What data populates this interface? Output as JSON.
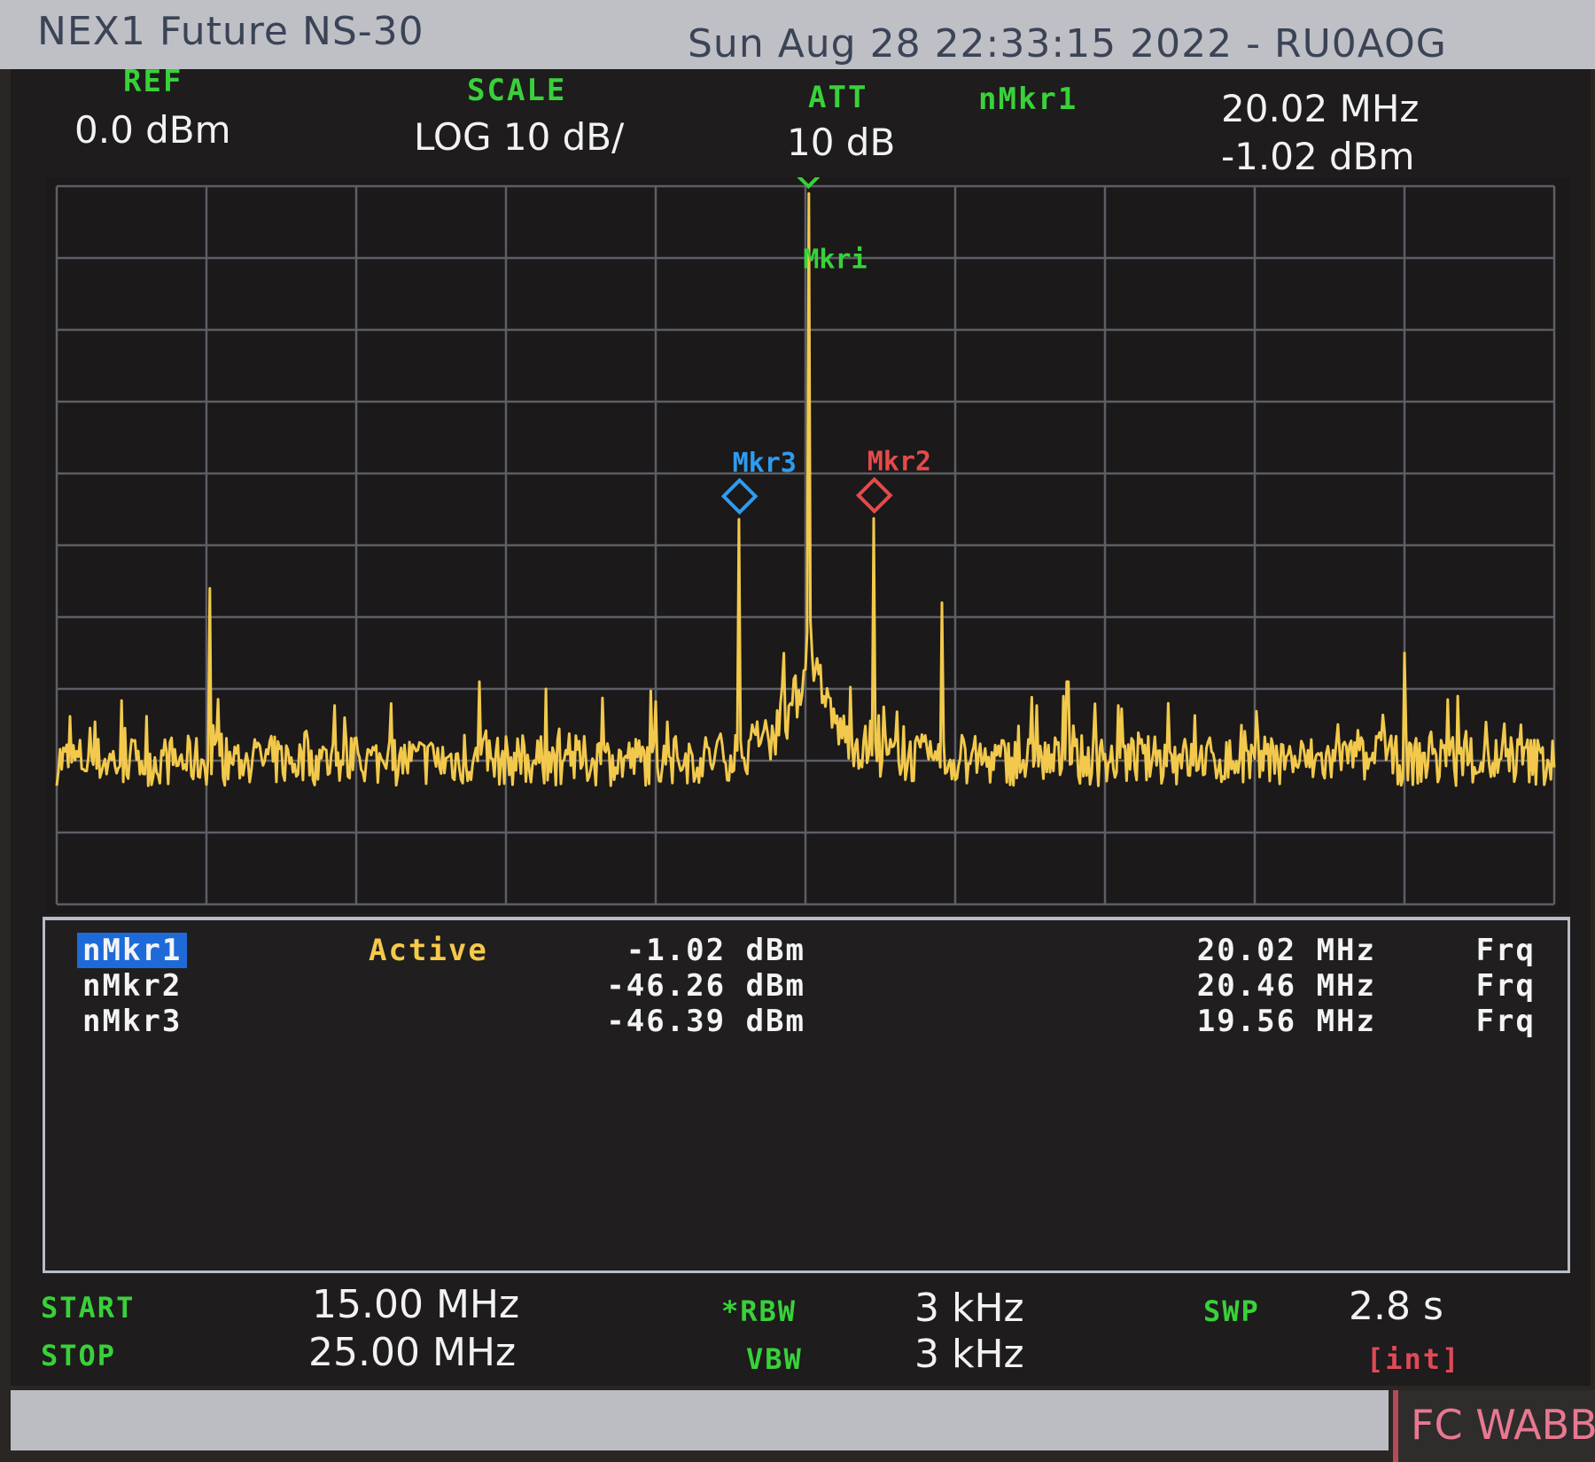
{
  "titlebar": {
    "device": "NEX1 Future NS-30",
    "datetime": "Sun Aug 28 22:33:15 2022 -  RU0AOG"
  },
  "header": {
    "ref_label": "REF",
    "ref_value": "0.0 dBm",
    "scale_label": "SCALE",
    "scale_value": "LOG 10 dB/",
    "att_label": "ATT",
    "att_value": "10 dB",
    "active_marker_label": "nMkr1",
    "active_marker_freq": "20.02 MHz",
    "active_marker_amp": "-1.02 dBm"
  },
  "chart_data": {
    "type": "line",
    "xlim": [
      15.0,
      25.0
    ],
    "ylim": [
      -100,
      0
    ],
    "x_unit": "MHz",
    "y_unit": "dBm",
    "grid": true,
    "grid_divisions": {
      "x": 10,
      "y": 10
    },
    "trace_color": "#f2c94c",
    "noise_floor": -80,
    "peaks": [
      {
        "x": 16.02,
        "y": -56
      },
      {
        "x": 16.92,
        "y": -74
      },
      {
        "x": 17.82,
        "y": -69
      },
      {
        "x": 18.27,
        "y": -70
      },
      {
        "x": 19.12,
        "y": -77
      },
      {
        "x": 19.56,
        "y": -46.39
      },
      {
        "x": 20.02,
        "y": -1.02
      },
      {
        "x": 20.46,
        "y": -46.26
      },
      {
        "x": 20.91,
        "y": -58
      },
      {
        "x": 21.75,
        "y": -69
      },
      {
        "x": 22.42,
        "y": -72
      },
      {
        "x": 23.12,
        "y": -78
      },
      {
        "x": 24.0,
        "y": -65
      },
      {
        "x": 24.36,
        "y": -71
      },
      {
        "x": 24.78,
        "y": -75
      }
    ],
    "markers": [
      {
        "label": "Mkri",
        "x": 20.02,
        "y": -1.02,
        "color": "#39d13a"
      },
      {
        "label": "Mkr2",
        "x": 20.46,
        "y": -46.26,
        "color": "#e54a4a"
      },
      {
        "label": "Mkr3",
        "x": 19.56,
        "y": -46.39,
        "color": "#2e9cf0"
      }
    ]
  },
  "marker_table": [
    {
      "name": "nMkr1",
      "state": "Active",
      "amp": "-1.02 dBm",
      "freq": "20.02 MHz",
      "mode": "Frq"
    },
    {
      "name": "nMkr2",
      "state": "",
      "amp": "-46.26 dBm",
      "freq": "20.46 MHz",
      "mode": "Frq"
    },
    {
      "name": "nMkr3",
      "state": "",
      "amp": "-46.39 dBm",
      "freq": "19.56 MHz",
      "mode": "Frq"
    }
  ],
  "footer": {
    "start_label": "START",
    "start_value": "15.00 MHz",
    "stop_label": "STOP",
    "stop_value": "25.00 MHz",
    "rbw_label": "*RBW",
    "rbw_value": "3 kHz",
    "vbw_label": "VBW",
    "vbw_value": "3 kHz",
    "swp_label": "SWP",
    "swp_value": "2.8 s",
    "swp_mode": "[int]"
  },
  "status_box": "FC WABB"
}
